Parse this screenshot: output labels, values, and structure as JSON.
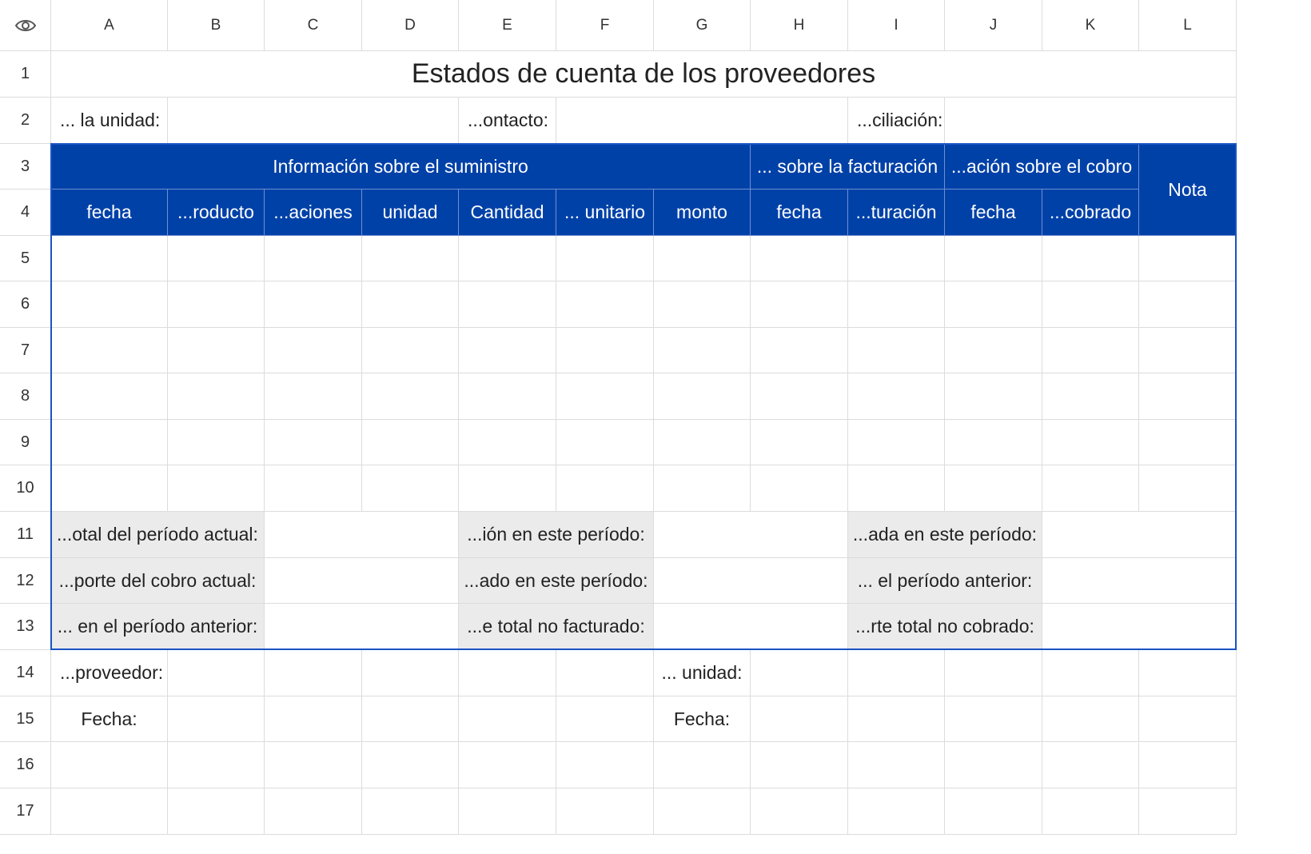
{
  "columns": [
    "A",
    "B",
    "C",
    "D",
    "E",
    "F",
    "G",
    "H",
    "I",
    "J",
    "K",
    "L"
  ],
  "rows": [
    "1",
    "2",
    "3",
    "4",
    "5",
    "6",
    "7",
    "8",
    "9",
    "10",
    "11",
    "12",
    "13",
    "14",
    "15",
    "16",
    "17"
  ],
  "corner_icon": "eye-icon",
  "title": "Estados de cuenta de los proveedores",
  "row2": {
    "unit_label": "... la unidad:",
    "contact_label": "...ontacto:",
    "reconciliation_label": "...ciliación:"
  },
  "header": {
    "supply_info": "Información sobre el suministro",
    "billing_info": "... sobre la facturación",
    "collection_info": "...ación sobre el cobro",
    "note": "Nota",
    "sub": [
      "fecha",
      "...roducto",
      "...aciones",
      "unidad",
      "Cantidad",
      "... unitario",
      "monto",
      "fecha",
      "...turación",
      "fecha",
      "...cobrado"
    ]
  },
  "summary": {
    "r11": [
      "...otal del período actual:",
      "...ión en este período:",
      "...ada en este período:"
    ],
    "r12": [
      "...porte del cobro actual:",
      "...ado en este período:",
      "... el período anterior:"
    ],
    "r13": [
      "... en el período anterior:",
      "...e total no facturado:",
      "...rte total no cobrado:"
    ]
  },
  "footer": {
    "supplier_label": "...proveedor:",
    "unit_label": "... unidad:",
    "date_a": "Fecha:",
    "date_g": "Fecha:"
  },
  "colors": {
    "header_blue": "#0041a8",
    "summary_gray": "#ebebeb",
    "outline_blue": "#1a54c4"
  }
}
